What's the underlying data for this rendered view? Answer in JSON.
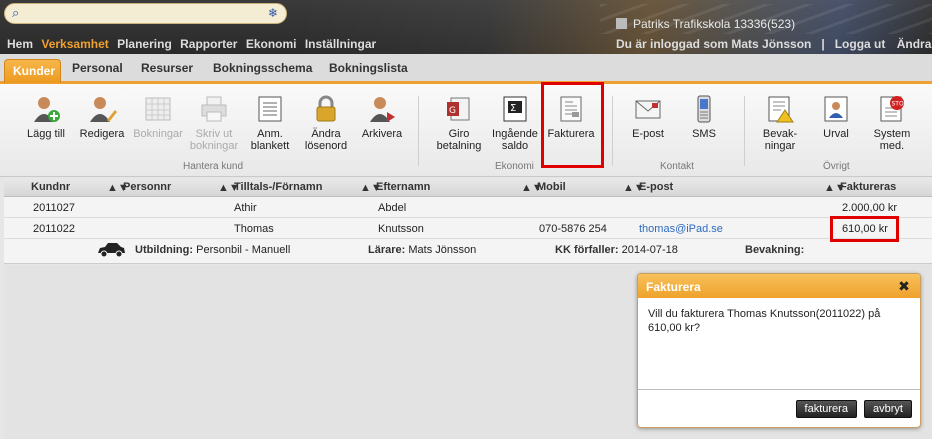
{
  "search": {
    "value": "",
    "placeholder": ""
  },
  "header": {
    "brand": "Patriks Trafikskola 13336(523)",
    "user_text": "Du är inloggad som Mats Jönsson",
    "separator": "|",
    "logout": "Logga ut",
    "truncated_link": "Ändra lö"
  },
  "nav": [
    "Hem",
    "Verksamhet",
    "Planering",
    "Rapporter",
    "Ekonomi",
    "Inställningar"
  ],
  "tabs": [
    "Kunder",
    "Personal",
    "Resurser",
    "Bokningsschema",
    "Bokningslista"
  ],
  "toolbar": {
    "add": [
      "Lägg till"
    ],
    "edit": [
      "Redigera"
    ],
    "bookings": [
      "Bokningar"
    ],
    "print": [
      "Skriv ut",
      "bokningar"
    ],
    "report": [
      "Anm.",
      "blankett"
    ],
    "password": [
      "Ändra",
      "lösenord"
    ],
    "archive": [
      "Arkivera"
    ],
    "giro": [
      "Giro",
      "betalning"
    ],
    "balance": [
      "Ingående",
      "saldo"
    ],
    "invoice": [
      "Fakturera"
    ],
    "email": [
      "E-post"
    ],
    "sms": [
      "SMS"
    ],
    "monitoring": [
      "Bevak-",
      "ningar"
    ],
    "selection": [
      "Urval"
    ],
    "system": [
      "System",
      "med."
    ],
    "groups": {
      "manage": "Hantera kund",
      "economy": "Ekonomi",
      "contact": "Kontakt",
      "other": "Övrigt"
    }
  },
  "table": {
    "columns": [
      "Kundnr",
      "Personnr",
      "Tilltals-/Förnamn",
      "Efternamn",
      "Mobil",
      "E-post",
      "Faktureras"
    ],
    "rows": [
      {
        "kundnr": "2011027",
        "personnr": "",
        "fornamn": "Athir",
        "efternamn": "Abdel",
        "mobil": "",
        "epost": "",
        "faktureras": "2.000,00 kr"
      },
      {
        "kundnr": "2011022",
        "personnr": "",
        "fornamn": "Thomas",
        "efternamn": "Knutsson",
        "mobil": "070-5876 254",
        "epost": "thomas@iPad.se",
        "faktureras": "610,00 kr"
      }
    ],
    "detail": {
      "utbildning_label": "Utbildning:",
      "utbildning": "Personbil - Manuell",
      "larare_label": "Lärare:",
      "larare": "Mats Jönsson",
      "kk_label": "KK förfaller:",
      "kk": "2014-07-18",
      "bevakning_label": "Bevakning:"
    }
  },
  "dialog": {
    "title": "Fakturera",
    "message_line1": "Vill du fakturera Thomas Knutsson(2011022) på",
    "message_line2": "610,00 kr?",
    "ok": "fakturera",
    "cancel": "avbryt"
  },
  "colors": {
    "accent": "#f0a030",
    "highlight": "#e00000",
    "link": "#2f6bc1"
  }
}
